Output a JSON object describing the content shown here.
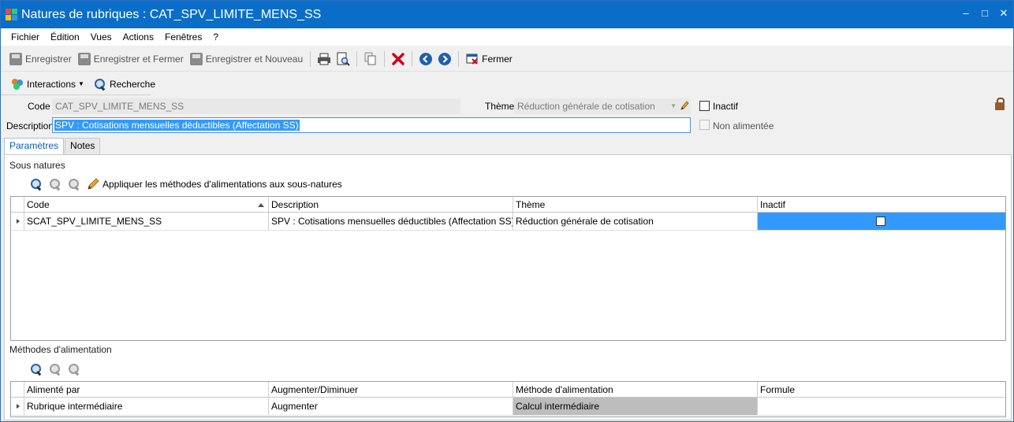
{
  "window": {
    "title": "Natures de rubriques : CAT_SPV_LIMITE_MENS_SS",
    "controls": {
      "minimize": "‒",
      "maximize": "□",
      "close": "✕"
    }
  },
  "menu": [
    "Fichier",
    "Édition",
    "Vues",
    "Actions",
    "Fenêtres",
    "?"
  ],
  "toolbar": {
    "save": "Enregistrer",
    "save_close": "Enregistrer et Fermer",
    "save_new": "Enregistrer et Nouveau",
    "close": "Fermer"
  },
  "toolbar2": {
    "interactions": "Interactions",
    "search": "Recherche"
  },
  "form": {
    "code_label": "Code",
    "code_value": "CAT_SPV_LIMITE_MENS_SS",
    "theme_label": "Thème",
    "theme_value": "Réduction générale de cotisation",
    "description_label": "Description",
    "description_value": "SPV : Cotisations mensuelles déductibles (Affectation SS)",
    "inactif_label": "Inactif",
    "non_alimentee_label": "Non alimentée"
  },
  "tabs": [
    "Paramètres",
    "Notes"
  ],
  "sous_natures": {
    "title": "Sous natures",
    "apply_label": "Appliquer les méthodes d'alimentations aux sous-natures",
    "columns": [
      "Code",
      "Description",
      "Thème",
      "Inactif"
    ],
    "rows": [
      {
        "code": "SCAT_SPV_LIMITE_MENS_SS",
        "description": "SPV : Cotisations mensuelles déductibles (Affectation SS)",
        "theme": "Réduction générale de cotisation",
        "inactif": false
      }
    ]
  },
  "methodes": {
    "title": "Méthodes d'alimentation",
    "columns": [
      "Alimenté par",
      "Augmenter/Diminuer",
      "Méthode d'alimentation",
      "Formule"
    ],
    "rows": [
      {
        "alimente_par": "Rubrique intermédiaire",
        "augmenter": "Augmenter",
        "methode": "Calcul intermédiaire",
        "formule": ""
      }
    ]
  },
  "colors": {
    "titlebar": "#0a6ec8",
    "selection": "#3399ff",
    "delete": "#d0021b"
  }
}
